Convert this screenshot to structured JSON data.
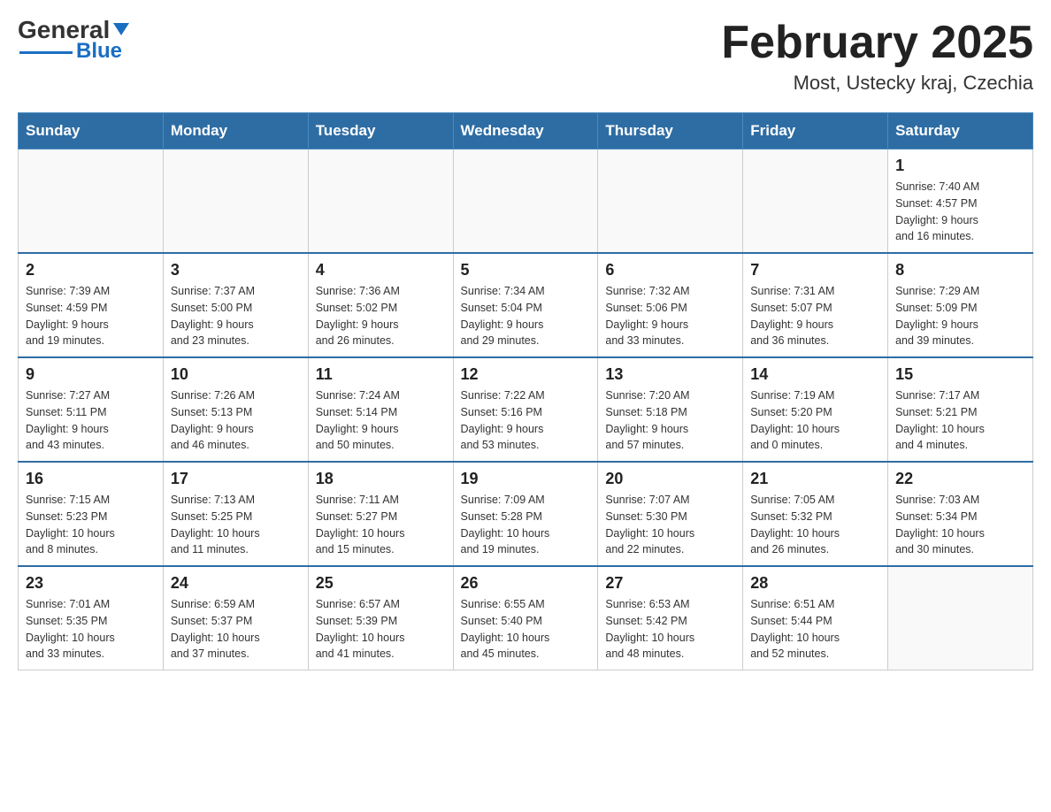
{
  "header": {
    "logo": {
      "text1": "General",
      "text2": "Blue"
    },
    "title": "February 2025",
    "subtitle": "Most, Ustecky kraj, Czechia"
  },
  "days_of_week": [
    "Sunday",
    "Monday",
    "Tuesday",
    "Wednesday",
    "Thursday",
    "Friday",
    "Saturday"
  ],
  "weeks": [
    [
      {
        "day": "",
        "info": ""
      },
      {
        "day": "",
        "info": ""
      },
      {
        "day": "",
        "info": ""
      },
      {
        "day": "",
        "info": ""
      },
      {
        "day": "",
        "info": ""
      },
      {
        "day": "",
        "info": ""
      },
      {
        "day": "1",
        "info": "Sunrise: 7:40 AM\nSunset: 4:57 PM\nDaylight: 9 hours\nand 16 minutes."
      }
    ],
    [
      {
        "day": "2",
        "info": "Sunrise: 7:39 AM\nSunset: 4:59 PM\nDaylight: 9 hours\nand 19 minutes."
      },
      {
        "day": "3",
        "info": "Sunrise: 7:37 AM\nSunset: 5:00 PM\nDaylight: 9 hours\nand 23 minutes."
      },
      {
        "day": "4",
        "info": "Sunrise: 7:36 AM\nSunset: 5:02 PM\nDaylight: 9 hours\nand 26 minutes."
      },
      {
        "day": "5",
        "info": "Sunrise: 7:34 AM\nSunset: 5:04 PM\nDaylight: 9 hours\nand 29 minutes."
      },
      {
        "day": "6",
        "info": "Sunrise: 7:32 AM\nSunset: 5:06 PM\nDaylight: 9 hours\nand 33 minutes."
      },
      {
        "day": "7",
        "info": "Sunrise: 7:31 AM\nSunset: 5:07 PM\nDaylight: 9 hours\nand 36 minutes."
      },
      {
        "day": "8",
        "info": "Sunrise: 7:29 AM\nSunset: 5:09 PM\nDaylight: 9 hours\nand 39 minutes."
      }
    ],
    [
      {
        "day": "9",
        "info": "Sunrise: 7:27 AM\nSunset: 5:11 PM\nDaylight: 9 hours\nand 43 minutes."
      },
      {
        "day": "10",
        "info": "Sunrise: 7:26 AM\nSunset: 5:13 PM\nDaylight: 9 hours\nand 46 minutes."
      },
      {
        "day": "11",
        "info": "Sunrise: 7:24 AM\nSunset: 5:14 PM\nDaylight: 9 hours\nand 50 minutes."
      },
      {
        "day": "12",
        "info": "Sunrise: 7:22 AM\nSunset: 5:16 PM\nDaylight: 9 hours\nand 53 minutes."
      },
      {
        "day": "13",
        "info": "Sunrise: 7:20 AM\nSunset: 5:18 PM\nDaylight: 9 hours\nand 57 minutes."
      },
      {
        "day": "14",
        "info": "Sunrise: 7:19 AM\nSunset: 5:20 PM\nDaylight: 10 hours\nand 0 minutes."
      },
      {
        "day": "15",
        "info": "Sunrise: 7:17 AM\nSunset: 5:21 PM\nDaylight: 10 hours\nand 4 minutes."
      }
    ],
    [
      {
        "day": "16",
        "info": "Sunrise: 7:15 AM\nSunset: 5:23 PM\nDaylight: 10 hours\nand 8 minutes."
      },
      {
        "day": "17",
        "info": "Sunrise: 7:13 AM\nSunset: 5:25 PM\nDaylight: 10 hours\nand 11 minutes."
      },
      {
        "day": "18",
        "info": "Sunrise: 7:11 AM\nSunset: 5:27 PM\nDaylight: 10 hours\nand 15 minutes."
      },
      {
        "day": "19",
        "info": "Sunrise: 7:09 AM\nSunset: 5:28 PM\nDaylight: 10 hours\nand 19 minutes."
      },
      {
        "day": "20",
        "info": "Sunrise: 7:07 AM\nSunset: 5:30 PM\nDaylight: 10 hours\nand 22 minutes."
      },
      {
        "day": "21",
        "info": "Sunrise: 7:05 AM\nSunset: 5:32 PM\nDaylight: 10 hours\nand 26 minutes."
      },
      {
        "day": "22",
        "info": "Sunrise: 7:03 AM\nSunset: 5:34 PM\nDaylight: 10 hours\nand 30 minutes."
      }
    ],
    [
      {
        "day": "23",
        "info": "Sunrise: 7:01 AM\nSunset: 5:35 PM\nDaylight: 10 hours\nand 33 minutes."
      },
      {
        "day": "24",
        "info": "Sunrise: 6:59 AM\nSunset: 5:37 PM\nDaylight: 10 hours\nand 37 minutes."
      },
      {
        "day": "25",
        "info": "Sunrise: 6:57 AM\nSunset: 5:39 PM\nDaylight: 10 hours\nand 41 minutes."
      },
      {
        "day": "26",
        "info": "Sunrise: 6:55 AM\nSunset: 5:40 PM\nDaylight: 10 hours\nand 45 minutes."
      },
      {
        "day": "27",
        "info": "Sunrise: 6:53 AM\nSunset: 5:42 PM\nDaylight: 10 hours\nand 48 minutes."
      },
      {
        "day": "28",
        "info": "Sunrise: 6:51 AM\nSunset: 5:44 PM\nDaylight: 10 hours\nand 52 minutes."
      },
      {
        "day": "",
        "info": ""
      }
    ]
  ]
}
